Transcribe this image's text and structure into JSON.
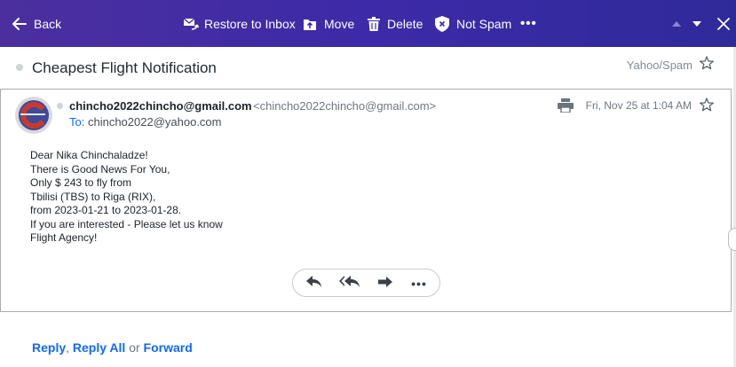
{
  "toolbar": {
    "back_label": "Back",
    "restore_label": "Restore to Inbox",
    "move_label": "Move",
    "delete_label": "Delete",
    "notspam_label": "Not Spam",
    "more_label": "•••"
  },
  "message": {
    "subject": "Cheapest Flight Notification",
    "folder": "Yahoo/Spam",
    "from_name": "chincho2022chincho@gmail.com",
    "from_email": "<chincho2022chincho@gmail.com>",
    "to_label": "To:",
    "to_address": "chincho2022@yahoo.com",
    "date": "Fri, Nov 25 at 1:04 AM",
    "body_lines": [
      "Dear Nika Chinchaladze!",
      "There is Good News For You,",
      "Only $ 243 to fly from",
      "Tbilisi (TBS) to Riga (RIX),",
      "from 2023-01-21 to 2023-01-28.",
      "If you are interested - Please let us know",
      "Flight Agency!"
    ]
  },
  "quick_reply": {
    "reply": "Reply",
    "comma": ",",
    "reply_all": "Reply All",
    "or": "or",
    "forward": "Forward"
  },
  "colors": {
    "toolbar_start": "#4b2f9e",
    "toolbar_end": "#2f2a9a",
    "link": "#0f69ff"
  }
}
